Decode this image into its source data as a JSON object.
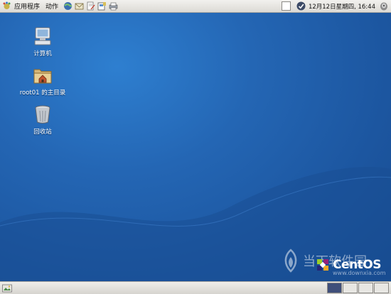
{
  "top_panel": {
    "menu_applications": "应用程序",
    "menu_actions": "动作",
    "launchers": [
      "web-browser-icon",
      "mail-icon",
      "text-editor-icon",
      "office-icon",
      "printer-icon"
    ],
    "clock": "12月12日星期四, 16:44"
  },
  "desktop": {
    "icons": [
      {
        "name": "computer",
        "label": "计算机",
        "icon": "computer-icon"
      },
      {
        "name": "home",
        "label": "root01 的主目录",
        "icon": "home-folder-icon"
      },
      {
        "name": "trash",
        "label": "回收站",
        "icon": "trash-icon"
      }
    ],
    "brand": "CentOS",
    "watermark_text": "当下软件园",
    "watermark_url": "www.downxia.com"
  },
  "bottom_panel": {
    "workspaces": 4,
    "active_workspace": 1
  },
  "colors": {
    "desktop_blue": "#2466b4",
    "panel_gray": "#dcdad5",
    "workspace_active": "#3f4f7a"
  }
}
